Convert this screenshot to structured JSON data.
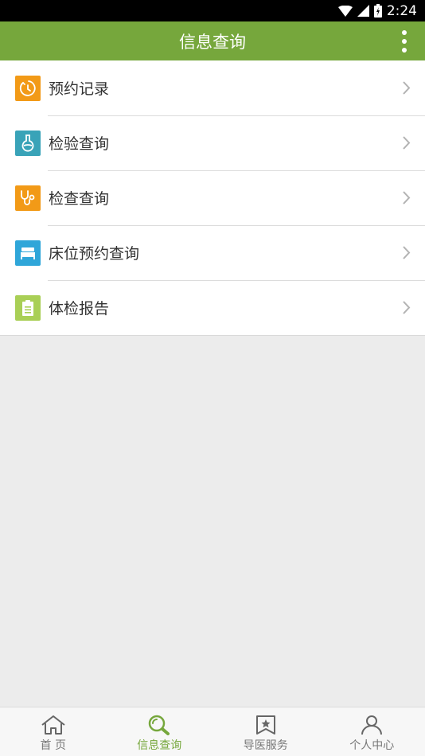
{
  "status_bar": {
    "time": "2:24"
  },
  "app_bar": {
    "title": "信息查询"
  },
  "menu": {
    "items": [
      {
        "label": "预约记录",
        "icon": "clock-icon",
        "color": "#f29a17"
      },
      {
        "label": "检验查询",
        "icon": "flask-icon",
        "color": "#39a3b8"
      },
      {
        "label": "检查查询",
        "icon": "stethoscope-icon",
        "color": "#f29a17"
      },
      {
        "label": "床位预约查询",
        "icon": "bed-icon",
        "color": "#2fa6d9"
      },
      {
        "label": "体检报告",
        "icon": "clipboard-icon",
        "color": "#a9cf56"
      }
    ]
  },
  "bottom_nav": {
    "tabs": [
      {
        "label": "首 页",
        "icon": "home-icon",
        "active": false
      },
      {
        "label": "信息查询",
        "icon": "search-icon",
        "active": true
      },
      {
        "label": "导医服务",
        "icon": "star-bookmark-icon",
        "active": false
      },
      {
        "label": "个人中心",
        "icon": "person-icon",
        "active": false
      }
    ]
  },
  "colors": {
    "primary": "#76a73c",
    "background": "#ececec"
  }
}
